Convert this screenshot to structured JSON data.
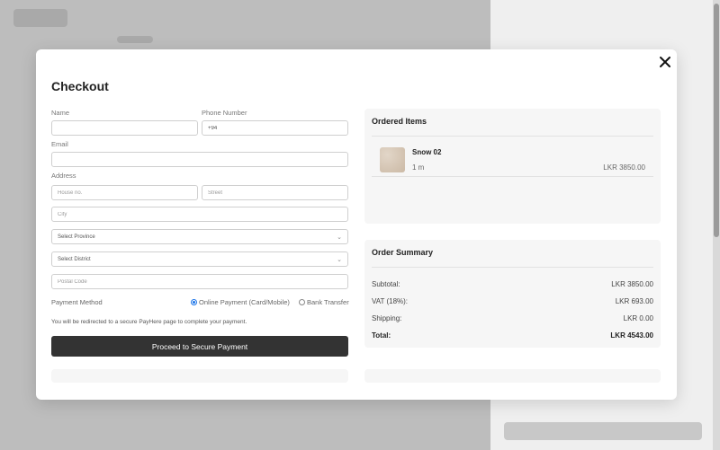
{
  "modal": {
    "title": "Checkout",
    "close_icon": "close-icon"
  },
  "form": {
    "name_label": "Name",
    "name_value": "",
    "phone_label": "Phone Number",
    "phone_value": "+94",
    "email_label": "Email",
    "email_value": "",
    "address_label": "Address",
    "house_placeholder": "House no.",
    "street_placeholder": "Street",
    "city_placeholder": "City",
    "province_selected": "Select Province",
    "district_selected": "Select District",
    "postal_placeholder": "Postal Code",
    "payment_method_label": "Payment Method",
    "payment_options": [
      {
        "label": "Online Payment (Card/Mobile)",
        "selected": true
      },
      {
        "label": "Bank Transfer",
        "selected": false
      }
    ],
    "redirect_note": "You will be redirected to a secure PayHere page to complete your payment.",
    "submit_label": "Proceed to Secure Payment"
  },
  "ordered_items": {
    "title": "Ordered Items",
    "items": [
      {
        "name": "Snow 02",
        "quantity": "1 m",
        "price": "LKR 3850.00"
      }
    ]
  },
  "order_summary": {
    "title": "Order Summary",
    "subtotal_label": "Subtotal:",
    "subtotal_value": "LKR 3850.00",
    "vat_label": "VAT (18%):",
    "vat_value": "LKR 693.00",
    "shipping_label": "Shipping:",
    "shipping_value": "LKR 0.00",
    "total_label": "Total:",
    "total_value": "LKR 4543.00"
  },
  "colors": {
    "accent": "#1a73e8",
    "button_bg": "#333333",
    "panel_bg": "#f6f6f6"
  }
}
